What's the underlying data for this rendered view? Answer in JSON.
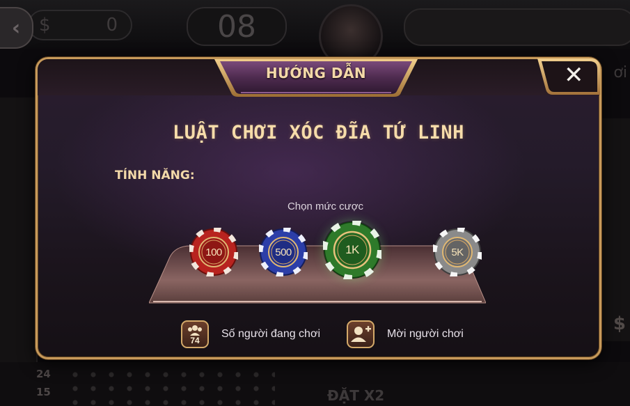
{
  "background": {
    "timer": "08",
    "balance_digit": "0",
    "right_text": "ơi",
    "right_symbol": "$",
    "bet_label": "ĐẶT X2",
    "side_numbers": [
      "24",
      "15"
    ]
  },
  "modal": {
    "title": "HƯỚNG DẪN",
    "close_label": "✕",
    "rules_title": "LUẬT CHƠI XÓC ĐĨA TỨ LINH",
    "features_label": "TÍNH NĂNG:",
    "choose_bet_label": "Chọn mức cược",
    "chips": [
      {
        "label": "100",
        "color": "#b8231f"
      },
      {
        "label": "500",
        "color": "#2c3ea8"
      },
      {
        "label": "1K",
        "color": "#2e7a2a"
      },
      {
        "label": "5K",
        "color": "#8a8a8a"
      }
    ],
    "players_count": "74",
    "players_label": "Số người đang chơi",
    "invite_label": "Mời người chơi"
  },
  "colors": {
    "gold": "#c79a5b",
    "title_text": "#f4d9a8",
    "panel_purple": "#241b2a"
  }
}
